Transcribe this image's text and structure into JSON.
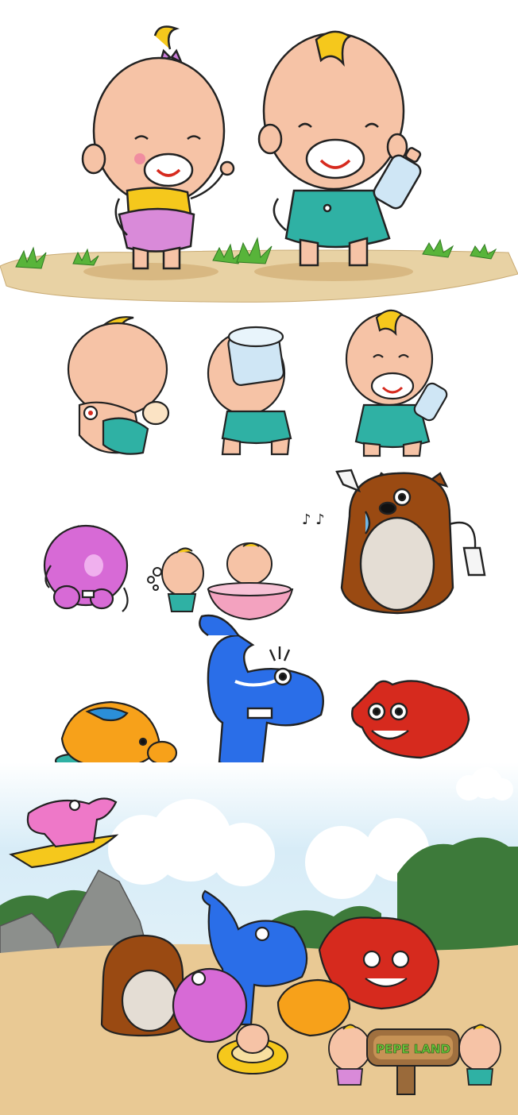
{
  "sign": {
    "text": "PEPE LAND"
  },
  "colors": {
    "skin": "#f6c3a6",
    "skin_shade": "#e9a184",
    "hair": "#f5c81c",
    "diaper_pink": "#d98ad9",
    "diaper_teal": "#2fb1a4",
    "ground_light": "#e8d2a4",
    "ground_dark": "#d8b882",
    "grass": "#58b43a",
    "bear_brown": "#9a4a12",
    "bear_belly": "#e4ddd4",
    "hippo_pink": "#d76ad6",
    "elephant_blue": "#2a6ee8",
    "pig_orange": "#f7a11a",
    "pig_blue_spot": "#2b8fd8",
    "red_monster": "#d62a1e",
    "pink_elephant": "#ee78c8",
    "sky": "#d7ecf7",
    "tree_green": "#3d7a3a",
    "rock_grey": "#8c8f8c",
    "sand": "#e9c994"
  },
  "icons": [
    "baby-girl-pink-diaper",
    "baby-boy-teal-diaper",
    "baby-crawling",
    "baby-drinking-bucket",
    "baby-with-bottle",
    "purple-hippo",
    "baby-brushing-teeth",
    "baby-in-tub",
    "brown-bear-with-towel",
    "orange-pig-lying",
    "blue-elephant-spraying",
    "red-monster",
    "pink-elephant-on-carpet",
    "pepe-land-sign"
  ]
}
